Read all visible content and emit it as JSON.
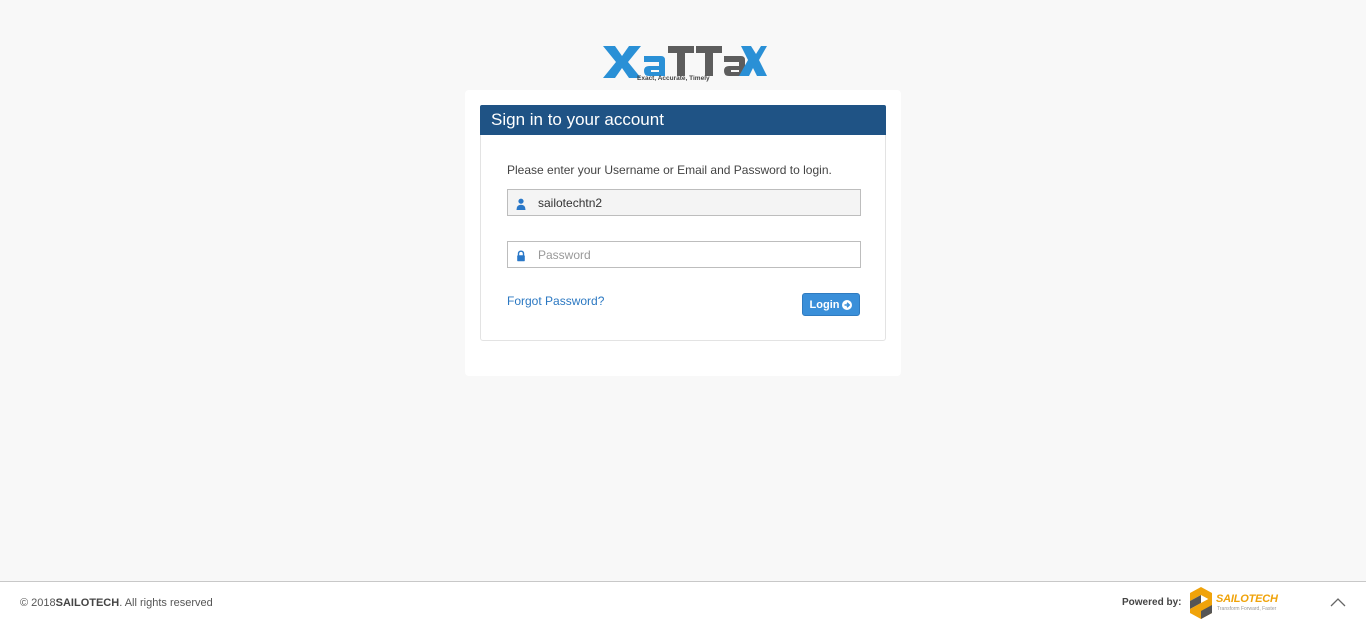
{
  "brand": {
    "logo_text": "XATTAX",
    "logo_tagline": "Exact, Accurate, Timely",
    "colors": {
      "blue": "#2a90d6",
      "gray": "#5d5d5d"
    }
  },
  "login": {
    "heading": "Sign in to your account",
    "instructions": "Please enter your Username or Email and Password to login.",
    "username": {
      "value": "sailotechtn2",
      "icon": "user-icon"
    },
    "password": {
      "value": "",
      "placeholder": "Password",
      "icon": "lock-icon"
    },
    "forgot_label": "Forgot Password?",
    "login_label": "Login",
    "login_icon": "arrow-circle-right-icon",
    "colors": {
      "heading_bg": "#1f5385",
      "button_bg": "#3a8fd9",
      "link": "#2b78c2"
    }
  },
  "footer": {
    "copyright_prefix": "© 2018",
    "copyright_brand": "SAILOTECH",
    "copyright_suffix": ". All rights reserved",
    "powered_by": "Powered by:",
    "sailotech_logo_name": "SAILOTECH",
    "sailotech_tagline": "Transform Forward, Faster",
    "scroll_top_icon": "chevron-up-icon"
  }
}
